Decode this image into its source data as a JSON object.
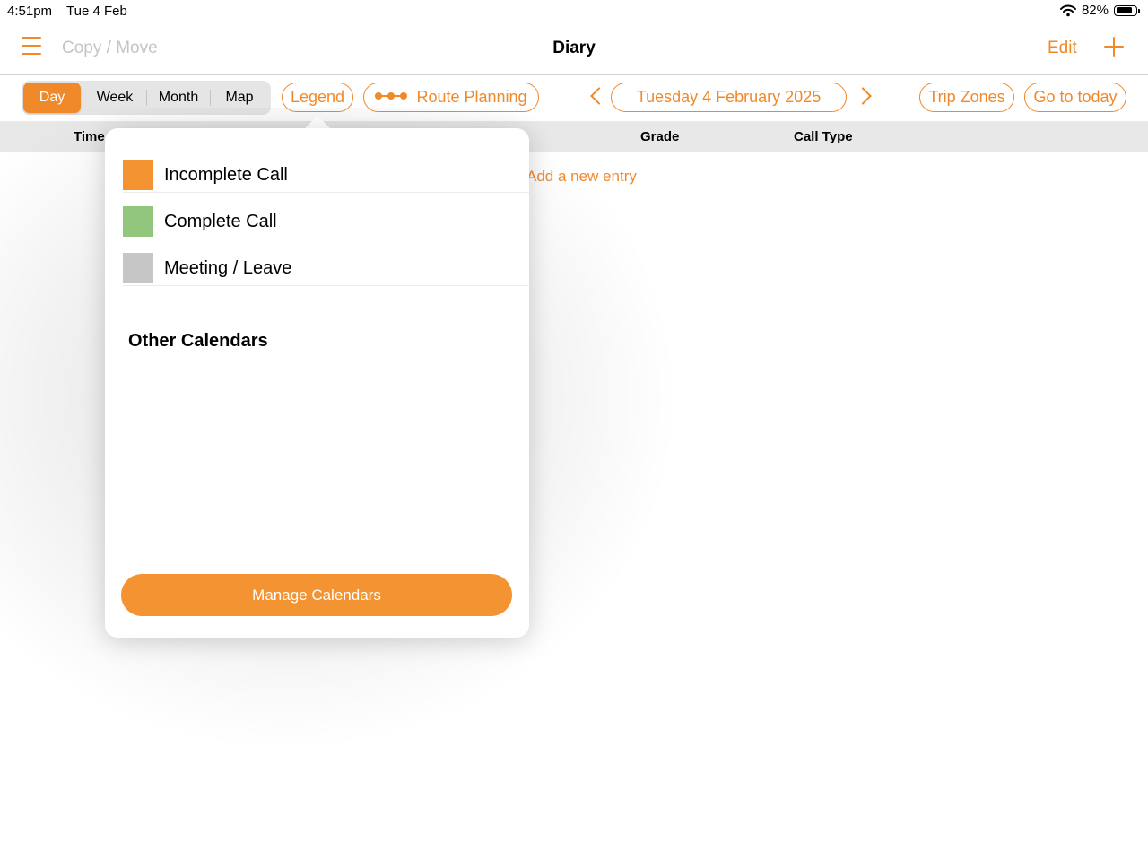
{
  "status_bar": {
    "time": "4:51pm",
    "date": "Tue 4 Feb",
    "battery_text": "82%",
    "battery_level": 0.82
  },
  "nav": {
    "copy_move": "Copy / Move",
    "title": "Diary",
    "edit": "Edit"
  },
  "view_tabs": [
    {
      "label": "Day",
      "selected": true
    },
    {
      "label": "Week",
      "selected": false
    },
    {
      "label": "Month",
      "selected": false
    },
    {
      "label": "Map",
      "selected": false
    }
  ],
  "toolbar": {
    "legend": "Legend",
    "route_planning": "Route Planning",
    "current_date": "Tuesday 4 February 2025",
    "trip_zones": "Trip Zones",
    "go_to_today": "Go to today"
  },
  "table": {
    "headers": {
      "time": "Time",
      "grade": "Grade",
      "call_type": "Call Type"
    },
    "add_entry": "Add a new entry"
  },
  "legend_popover": {
    "items": [
      {
        "label": "Incomplete Call",
        "color": "#f39331"
      },
      {
        "label": "Complete Call",
        "color": "#93c67d"
      },
      {
        "label": "Meeting / Leave",
        "color": "#c6c6c6"
      }
    ],
    "other_calendars_title": "Other Calendars",
    "manage_button": "Manage Calendars"
  },
  "colors": {
    "accent": "#f0892a"
  }
}
